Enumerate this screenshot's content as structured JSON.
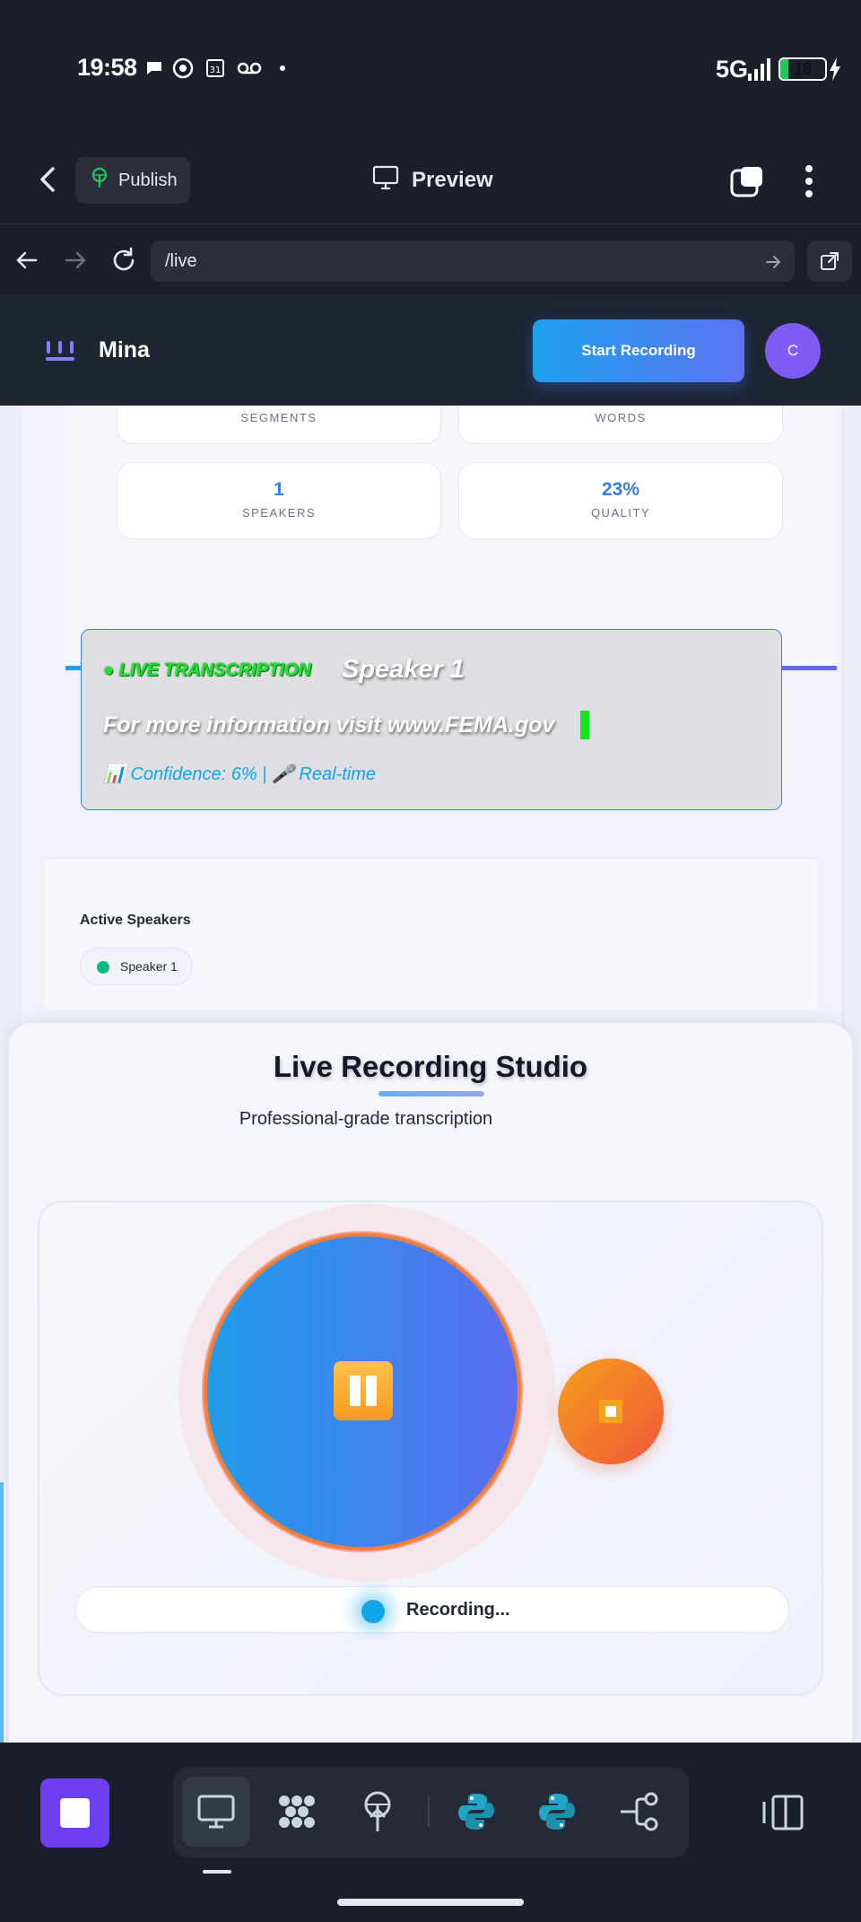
{
  "status_bar": {
    "time": "19:58",
    "network": "5G",
    "battery": "18",
    "battery_level": 0.18
  },
  "app_bar": {
    "publish_label": "Publish",
    "preview_label": "Preview"
  },
  "browser": {
    "url": "/live"
  },
  "site": {
    "brand": "Mina",
    "start_recording_label": "Start Recording",
    "avatar_initial": "C"
  },
  "stats": {
    "segments_label": "SEGMENTS",
    "words_label": "WORDS",
    "speakers_value": "1",
    "speakers_label": "SPEAKERS",
    "quality_value": "23%",
    "quality_label": "QUALITY"
  },
  "live_transcription": {
    "tag": "● LIVE TRANSCRIPTION",
    "speaker": "Speaker 1",
    "text": "For more information visit www.FEMA.gov",
    "meta": "📊 Confidence: 6% | 🎤 Real-time"
  },
  "active_speakers": {
    "title": "Active Speakers",
    "chips": [
      "Speaker 1"
    ]
  },
  "studio": {
    "title": "Live Recording Studio",
    "subtitle": "Professional-grade transcription",
    "status": "Recording..."
  },
  "colors": {
    "accent": "#1ea1ee",
    "brand_purple": "#7c5cf2",
    "recording_blue": "#13a5e9",
    "stop_orange": "#f0563b"
  },
  "icons": [
    "back-icon",
    "publish-icon",
    "monitor-icon",
    "tabs-icon",
    "menu-dots-icon",
    "arrow-left-icon",
    "arrow-right-icon",
    "reload-icon",
    "external-link-icon",
    "brand-logo-icon",
    "pause-icon",
    "stop-icon",
    "desktop-icon",
    "graph-icon",
    "deploy-icon",
    "python-icon",
    "branch-icon",
    "side-panel-icon"
  ]
}
